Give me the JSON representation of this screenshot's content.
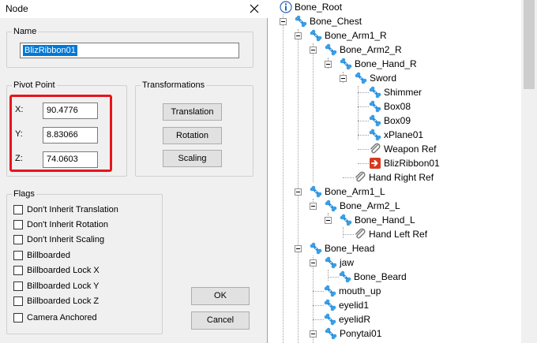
{
  "dialog": {
    "title": "Node",
    "name_group": {
      "label": "Name",
      "value": "BlizRibbon01"
    },
    "pivot_group": {
      "label": "Pivot Point",
      "x_label": "X:",
      "x_value": "90.4776",
      "y_label": "Y:",
      "y_value": "8.83066",
      "z_label": "Z:",
      "z_value": "74.0603"
    },
    "transform_group": {
      "label": "Transformations",
      "translation": "Translation",
      "rotation": "Rotation",
      "scaling": "Scaling"
    },
    "flags_group": {
      "label": "Flags",
      "items": [
        "Don't Inherit Translation",
        "Don't Inherit Rotation",
        "Don't Inherit Scaling",
        "Billboarded",
        "Billboarded Lock X",
        "Billboarded Lock Y",
        "Billboarded Lock Z",
        "Camera Anchored"
      ]
    },
    "ok": "OK",
    "cancel": "Cancel"
  },
  "highlight_color": "#e8141b",
  "tree": {
    "nodes": [
      {
        "label": "Bone_Root",
        "icon": "info-icon"
      },
      {
        "label": "Bone_Chest",
        "icon": "bone-icon"
      },
      {
        "label": "Bone_Arm1_R",
        "icon": "bone-icon"
      },
      {
        "label": "Bone_Arm2_R",
        "icon": "bone-icon"
      },
      {
        "label": "Bone_Hand_R",
        "icon": "bone-icon"
      },
      {
        "label": "Sword",
        "icon": "bone-icon"
      },
      {
        "label": "Shimmer",
        "icon": "bone-icon"
      },
      {
        "label": "Box08",
        "icon": "bone-icon"
      },
      {
        "label": "Box09",
        "icon": "bone-icon"
      },
      {
        "label": "xPlane01",
        "icon": "bone-icon"
      },
      {
        "label": "Weapon Ref",
        "icon": "paperclip-icon"
      },
      {
        "label": "BlizRibbon01",
        "icon": "ribbon-emitter-icon"
      },
      {
        "label": "Hand Right Ref",
        "icon": "paperclip-icon"
      },
      {
        "label": "Bone_Arm1_L",
        "icon": "bone-icon"
      },
      {
        "label": "Bone_Arm2_L",
        "icon": "bone-icon"
      },
      {
        "label": "Bone_Hand_L",
        "icon": "bone-icon"
      },
      {
        "label": "Hand Left Ref",
        "icon": "paperclip-icon"
      },
      {
        "label": "Bone_Head",
        "icon": "bone-icon"
      },
      {
        "label": "jaw",
        "icon": "bone-icon"
      },
      {
        "label": "Bone_Beard",
        "icon": "bone-icon"
      },
      {
        "label": "mouth_up",
        "icon": "bone-icon"
      },
      {
        "label": "eyelid1",
        "icon": "bone-icon"
      },
      {
        "label": "eyelidR",
        "icon": "bone-icon"
      },
      {
        "label": "Ponytai01",
        "icon": "bone-icon"
      }
    ]
  }
}
